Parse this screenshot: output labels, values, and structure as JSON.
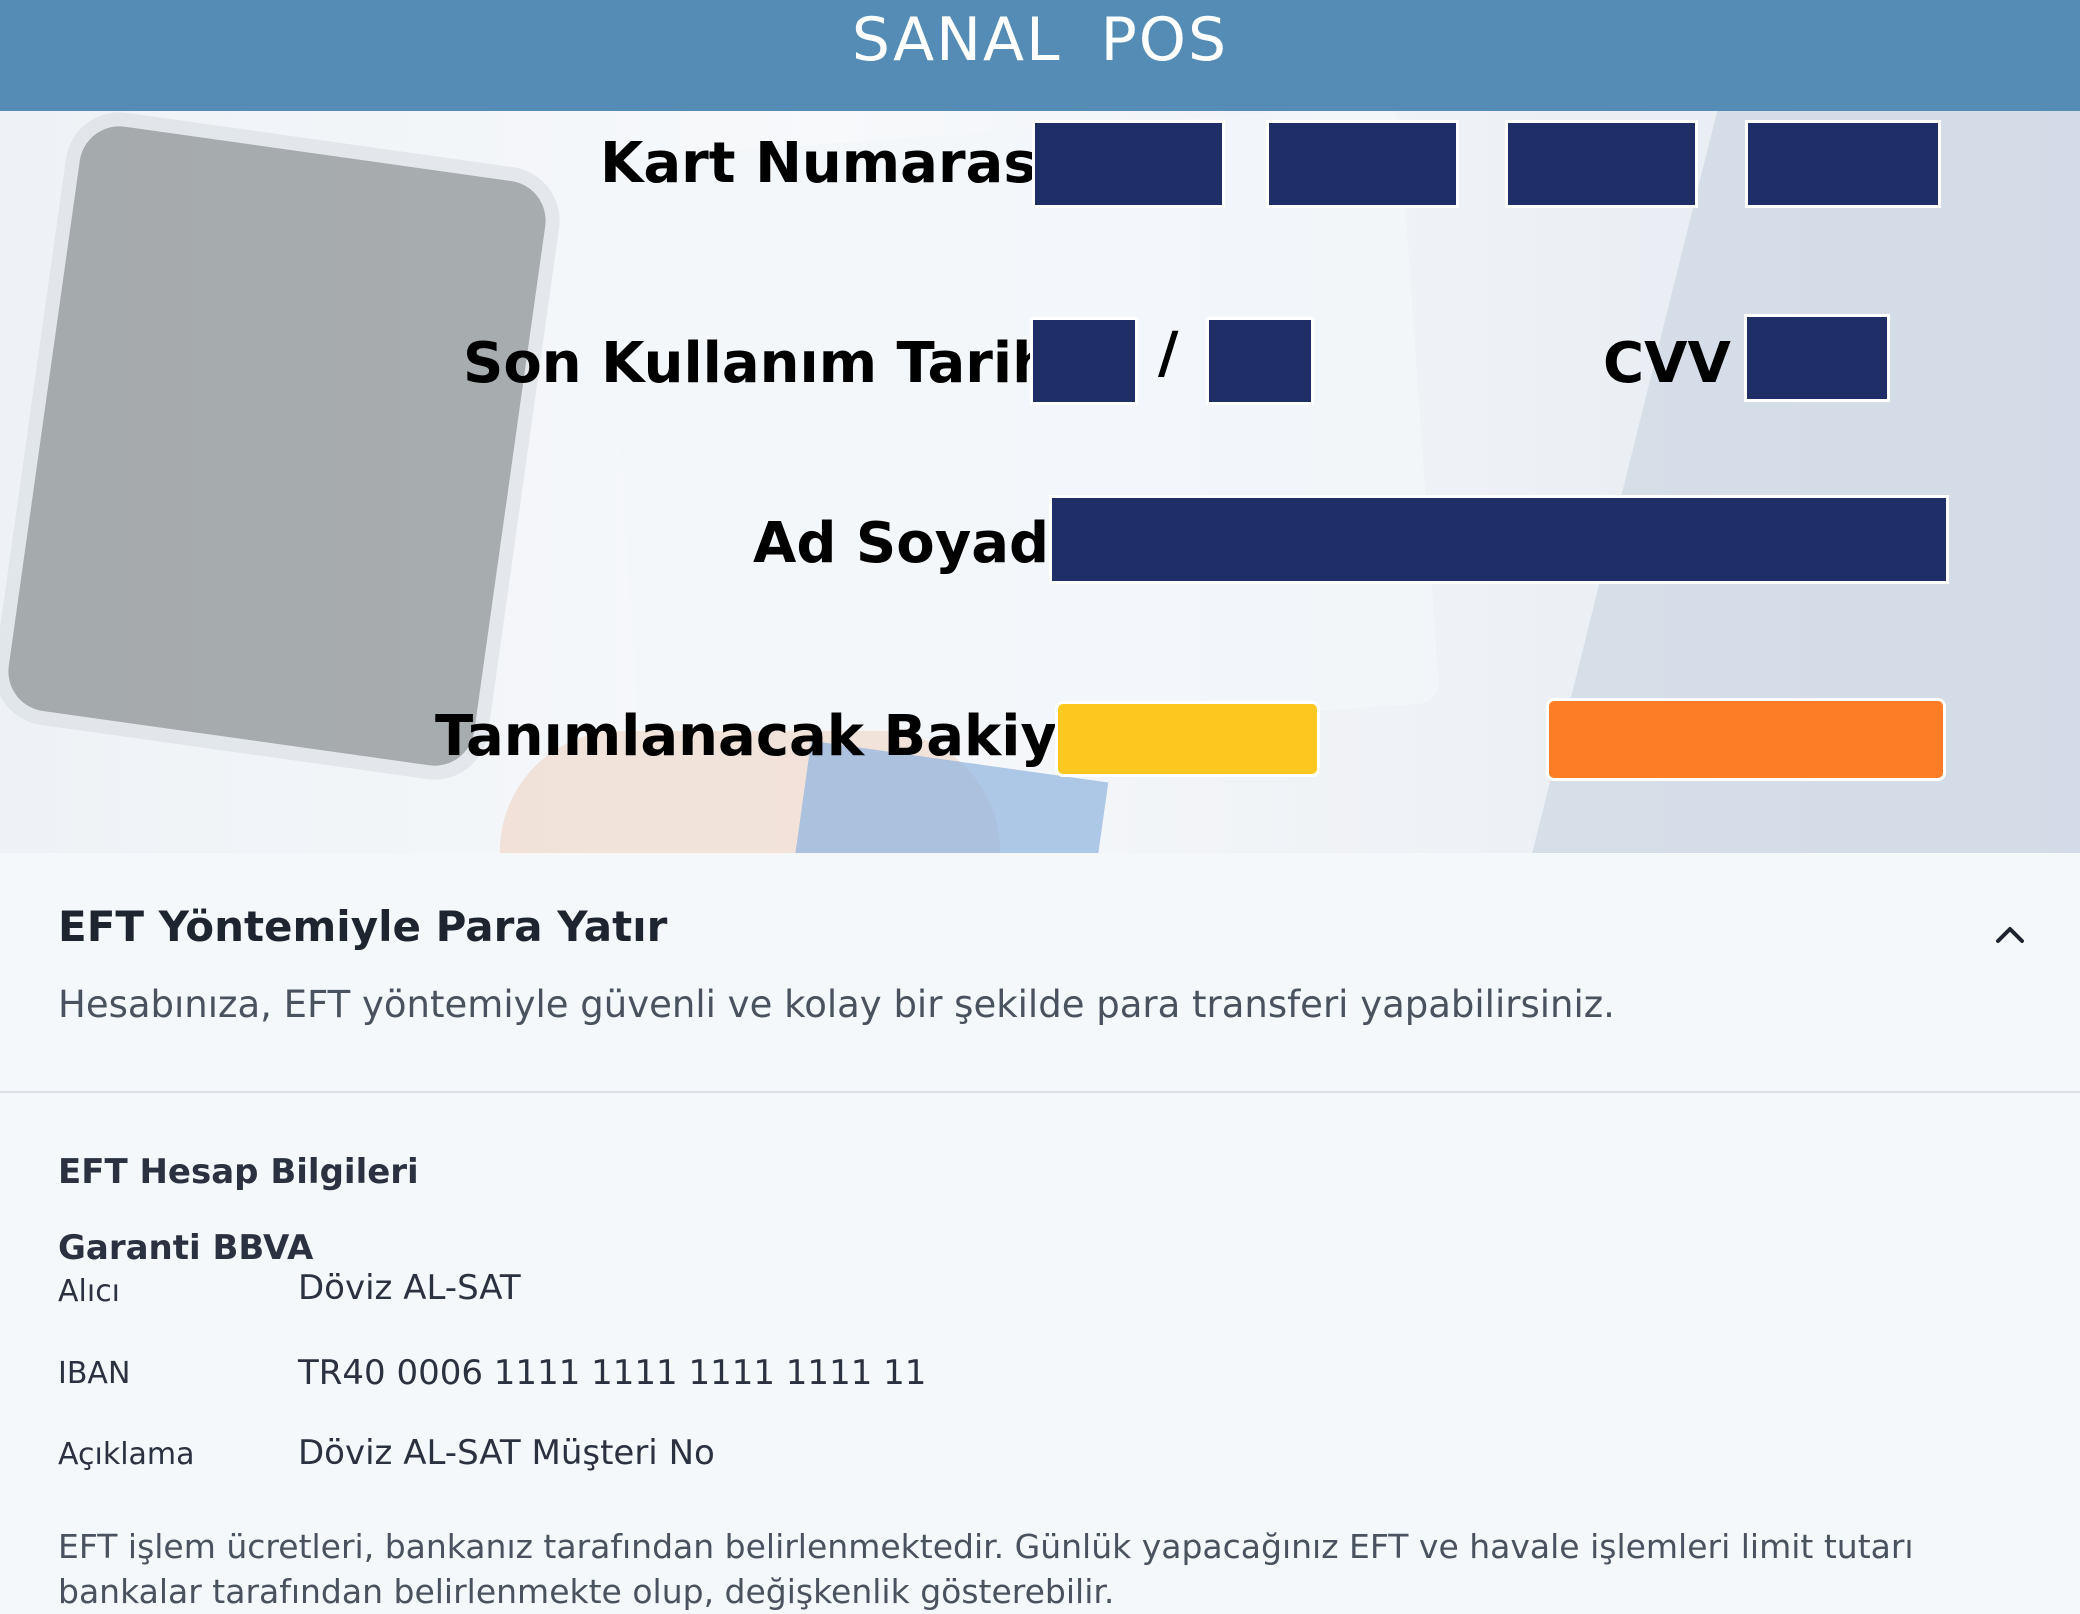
{
  "header": {
    "title": "SANAL  POS"
  },
  "form": {
    "card_number_label": "Kart Numarası",
    "expiry_label": "Son Kullanım Tarihi",
    "expiry_separator": "/",
    "cvv_label": "CVV",
    "name_label": "Ad Soyad",
    "balance_label": "Tanımlanacak Bakiye"
  },
  "eft": {
    "title": "EFT Yöntemiyle Para Yatır",
    "description": "Hesabınıza, EFT yöntemiyle güvenli ve kolay bir şekilde para transferi yapabilirsiniz.",
    "section_title": "EFT Hesap Bilgileri",
    "bank": "Garanti BBVA",
    "rows": [
      {
        "key": "Alıcı",
        "value": "Döviz AL-SAT"
      },
      {
        "key": "IBAN",
        "value": "TR40 0006 1111 1111 1111 1111 11"
      },
      {
        "key": "Açıklama",
        "value": "Döviz AL-SAT Müşteri No"
      }
    ],
    "note": "EFT işlem ücretleri, bankanız tarafından belirlenmektedir. Günlük yapacağınız EFT ve havale işlemleri limit tutarı bankalar tarafından belirlenmekte olup, değişkenlik gösterebilir."
  },
  "colors": {
    "header": "#548cb5",
    "input_fill": "#1f2e66",
    "balance_option_1": "#fcc81f",
    "balance_option_2": "#fd7c26"
  }
}
